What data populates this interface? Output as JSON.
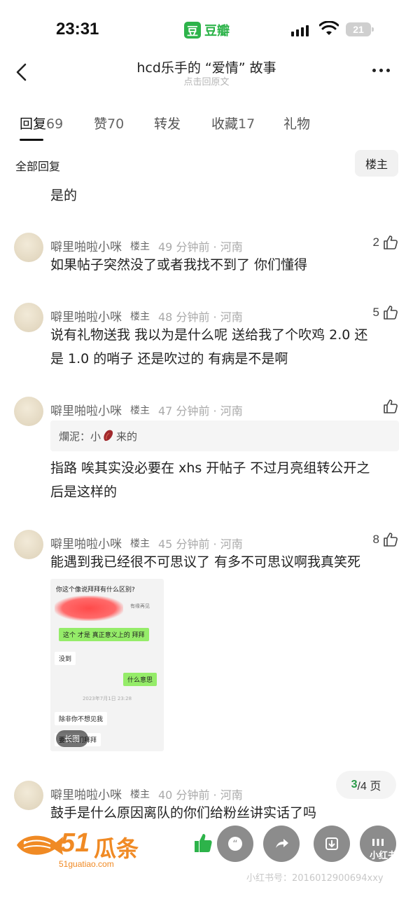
{
  "status_bar": {
    "time": "23:31",
    "app_logo_char": "豆",
    "app_name": "豆瓣",
    "battery": "21",
    "icons": [
      "cellular-signal-icon",
      "wifi-icon",
      "battery-icon"
    ]
  },
  "header": {
    "title": "hcd乐手的 “爱情” 故事",
    "subtitle": "点击回原文"
  },
  "tabs": [
    {
      "label": "回复",
      "count": "69"
    },
    {
      "label": "赞",
      "count": "70"
    },
    {
      "label": "转发",
      "count": ""
    },
    {
      "label": "收藏",
      "count": "17"
    },
    {
      "label": "礼物",
      "count": ""
    }
  ],
  "filter": {
    "label": "全部回复",
    "button": "楼主"
  },
  "previous_text": "是的",
  "comments": [
    {
      "user": "噼里啪啦小咪",
      "badge": "楼主",
      "time": "49 分钟前 · 河南",
      "likes": "2",
      "text": "如果帖子突然没了或者我找不到了 你们懂得"
    },
    {
      "user": "噼里啪啦小咪",
      "badge": "楼主",
      "time": "48 分钟前 · 河南",
      "likes": "5",
      "text_line1": "说有礼物送我 我以为是什么呢 送给我了个吹鸡 2.0 还",
      "text_line2": "是 1.0 的哨子 还是吹过的 有病是不是啊"
    },
    {
      "user": "噼里啪啦小咪",
      "badge": "楼主",
      "time": "47 分钟前 · 河南",
      "likes": "",
      "quote_prefix": "爛泥：小",
      "quote_suffix": "来的",
      "text_line1": "指路 唉其实没必要在 xhs 开帖子 不过月亮组转公开之",
      "text_line2": "后是这样的"
    },
    {
      "user": "噼里啪啦小咪",
      "badge": "楼主",
      "time": "45 分钟前 · 河南",
      "likes": "8",
      "text": "能遇到我已经很不可思议了 有多不可思议啊我真笑死"
    },
    {
      "user": "噼里啪啦小咪",
      "badge": "楼主",
      "time": "40 分钟前 · 河南",
      "likes": "",
      "text": "鼓手是什么原因离队的你们给粉丝讲实话了吗"
    }
  ],
  "chat_image": {
    "question": "你这个像说拜拜有什么区别?",
    "seen": "有缘再见",
    "msg_green_1": "这个 才是 真正意义上的 拜拜",
    "msg_white_1": "没到",
    "msg_green_2": "什么意思",
    "date": "2023年7月1日 23:28",
    "msg_white_2": "除非你不想见我",
    "msg_white_3": "要不我们拜拜",
    "long_image_label": "长图"
  },
  "pager": {
    "current": "3",
    "total": "/4 页"
  },
  "bottom_bar": {
    "brand_number": "51",
    "brand_name": "瓜条",
    "brand_url": "51guatiao.com",
    "xhs_label": "小红书",
    "watermark": "小红书号：2016012900694xxy",
    "colors": {
      "brand": "#f08a24",
      "like_green": "#2db34a"
    }
  }
}
